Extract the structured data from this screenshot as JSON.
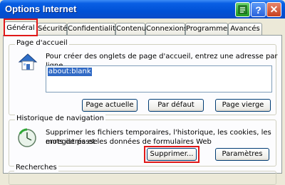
{
  "window": {
    "title": "Options Internet",
    "help_glyph": "?",
    "close_glyph": "✕"
  },
  "tabs": [
    "Général",
    "Sécurité",
    "Confidentialité",
    "Contenu",
    "Connexions",
    "Programmes",
    "Avancés"
  ],
  "homepage": {
    "group_title": "Page d'accueil",
    "description": "Pour créer des onglets de page d'accueil, entrez une adresse par ligne.",
    "url_value": "about:blank",
    "buttons": {
      "current": "Page actuelle",
      "default": "Par défaut",
      "blank": "Page vierge"
    }
  },
  "history": {
    "group_title": "Historique de navigation",
    "description_line1": "Supprimer les fichiers temporaires, l'historique, les cookies, les mots de passe",
    "description_line2": "enregistrés et les données de formulaires Web",
    "buttons": {
      "delete": "Supprimer...",
      "settings": "Paramètres"
    }
  },
  "search": {
    "group_title": "Recherches"
  },
  "colors": {
    "titlebar": "#0051d6",
    "highlight": "#e01818",
    "selection": "#316ac5"
  }
}
